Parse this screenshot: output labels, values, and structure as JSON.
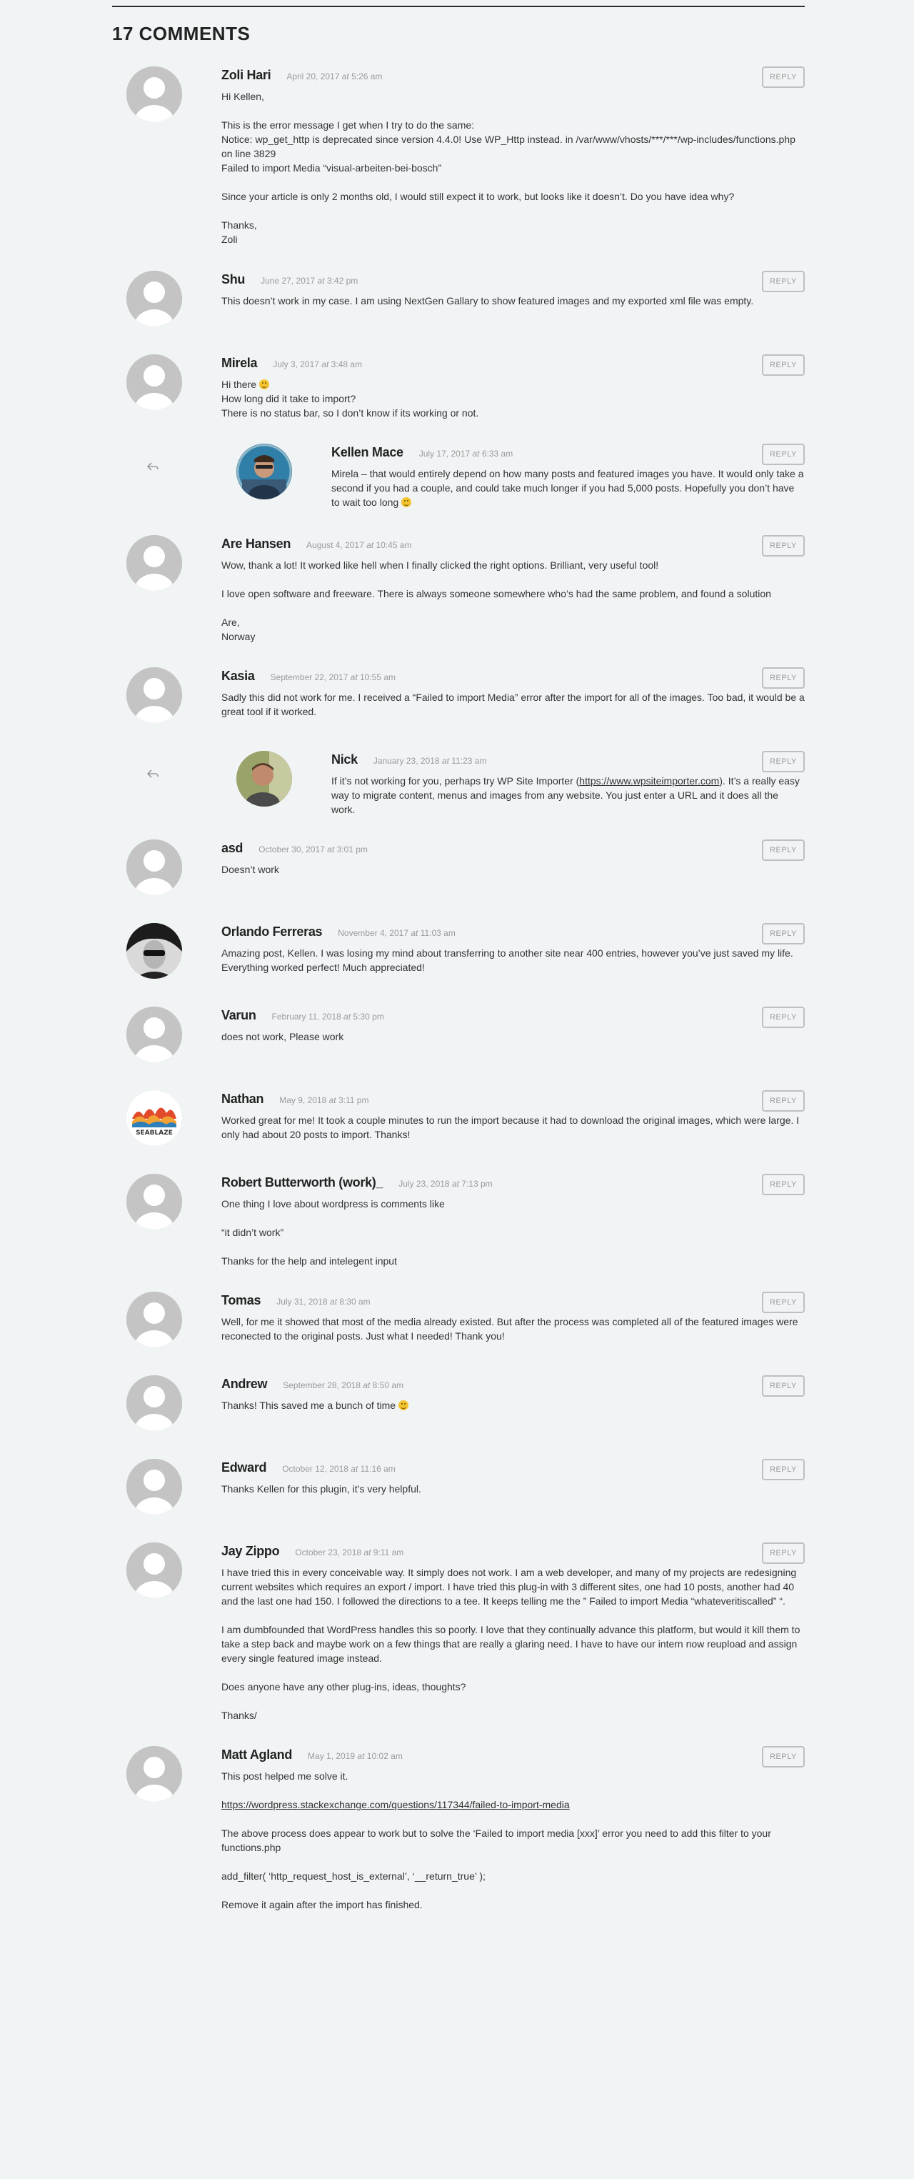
{
  "comments_title": "17 Comments",
  "reply_label": "Reply",
  "comments": [
    {
      "author": "Zoli Hari",
      "date": "April 20, 2017",
      "time": "5:26 am",
      "avatar": "default-avatar",
      "paragraphs": [
        "Hi Kellen,",
        "This is the error message I get when I try to do the same:\nNotice: wp_get_http is deprecated since version 4.4.0! Use WP_Http instead. in /var/www/vhosts/***/***/wp-includes/functions.php on line 3829\nFailed to import Media “visual-arbeiten-bei-bosch”",
        "Since your article is only 2 months old, I would still expect it to work, but looks like it doesn’t. Do you have idea why?",
        "Thanks,\nZoli"
      ]
    },
    {
      "author": "Shu",
      "date": "June 27, 2017",
      "time": "3:42 pm",
      "avatar": "default-avatar",
      "paragraphs": [
        "This doesn’t work in my case. I am using NextGen Gallary to show featured images and my exported xml file was empty."
      ]
    },
    {
      "author": "Mirela",
      "date": "July 3, 2017",
      "time": "3:48 am",
      "avatar": "default-avatar",
      "paragraphs": [
        "Hi there [smile]\nHow long did it take to import?\nThere is no status bar, so I don’t know if its working or not."
      ]
    },
    {
      "author": "Kellen Mace",
      "date": "July 17, 2017",
      "time": "6:33 am",
      "avatar": "kellen-photo",
      "child": true,
      "paragraphs": [
        "Mirela – that would entirely depend on how many posts and featured images you have. It would only take a second if you had a couple, and could take much longer if you had 5,000 posts. Hopefully you don’t have to wait too long [smile]"
      ]
    },
    {
      "author": "Are Hansen",
      "date": "August 4, 2017",
      "time": "10:45 am",
      "avatar": "default-avatar",
      "paragraphs": [
        "Wow, thank a lot! It worked like hell when I finally clicked the right options. Brilliant, very useful tool!",
        "I love open software and freeware. There is always someone somewhere who’s had the same problem, and found a solution",
        "Are,\nNorway"
      ]
    },
    {
      "author": "Kasia",
      "date": "September 22, 2017",
      "time": "10:55 am",
      "avatar": "default-avatar",
      "paragraphs": [
        "Sadly this did not work for me. I received a “Failed to import Media” error after the import for all of the images. Too bad, it would be a great tool if it worked."
      ]
    },
    {
      "author": "Nick",
      "date": "January 23, 2018",
      "time": "11:23 am",
      "avatar": "nick-photo",
      "child": true,
      "paragraphs": [
        "If it’s not working for you, perhaps try WP Site Importer ([link:https://www.wpsiteimporter.com]). It’s a really easy way to migrate content, menus and images from any website. You just enter a URL and it does all the work."
      ]
    },
    {
      "author": "asd",
      "date": "October 30, 2017",
      "time": "3:01 pm",
      "avatar": "default-avatar",
      "paragraphs": [
        "Doesn’t work"
      ]
    },
    {
      "author": "Orlando Ferreras",
      "date": "November 4, 2017",
      "time": "11:03 am",
      "avatar": "orlando-photo",
      "paragraphs": [
        "Amazing post, Kellen. I was losing my mind about transferring to another site near 400 entries, however you’ve just saved my life. Everything worked perfect! Much appreciated!"
      ]
    },
    {
      "author": "Varun",
      "date": "February 11, 2018",
      "time": "5:30 pm",
      "avatar": "default-avatar",
      "paragraphs": [
        "does not work, Please work"
      ]
    },
    {
      "author": "Nathan",
      "date": "May 9, 2018",
      "time": "3:11 pm",
      "avatar": "seablazer-logo",
      "logo_text": "SEABLAZE",
      "paragraphs": [
        "Worked great for me! It took a couple minutes to run the import because it had to download the original images, which were large. I only had about 20 posts to import. Thanks!"
      ]
    },
    {
      "author": "Robert Butterworth (work)_",
      "date": "July 23, 2018",
      "time": "7:13 pm",
      "avatar": "default-avatar",
      "paragraphs": [
        "One thing I love about wordpress is comments like",
        "“it didn’t work”",
        "Thanks for the help and intelegent input"
      ]
    },
    {
      "author": "Tomas",
      "date": "July 31, 2018",
      "time": "8:30 am",
      "avatar": "default-avatar",
      "paragraphs": [
        "Well, for me it showed that most of the media already existed. But after the process was completed all of the featured images were reconected to the original posts. Just what I needed! Thank you!"
      ]
    },
    {
      "author": "Andrew",
      "date": "September 28, 2018",
      "time": "8:50 am",
      "avatar": "default-avatar",
      "paragraphs": [
        "Thanks! This saved me a bunch of time [smile]"
      ]
    },
    {
      "author": "Edward",
      "date": "October 12, 2018",
      "time": "11:16 am",
      "avatar": "default-avatar",
      "paragraphs": [
        "Thanks Kellen for this plugin, it’s very helpful."
      ]
    },
    {
      "author": "Jay Zippo",
      "date": "October 23, 2018",
      "time": "9:11 am",
      "avatar": "default-avatar",
      "paragraphs": [
        "I have tried this in every conceivable way. It simply does not work. I am a web developer, and many of my projects are redesigning current websites which requires an export / import. I have tried this plug-in with 3 different sites, one had 10 posts, another had 40 and the last one had 150. I followed the directions to a tee. It keeps telling me the ” Failed to import Media “whateveritiscalled” “.",
        "I am dumbfounded that WordPress handles this so poorly. I love that they continually advance this platform, but would it kill them to take a step back and maybe work on a few things that are really a glaring need. I have to have our intern now reupload and assign every single featured image instead.",
        "Does anyone have any other plug-ins, ideas, thoughts?",
        "Thanks/"
      ]
    },
    {
      "author": "Matt Agland",
      "date": "May 1, 2019",
      "time": "10:02 am",
      "avatar": "default-avatar",
      "paragraphs": [
        "This post helped me solve it.",
        "[link:https://wordpress.stackexchange.com/questions/117344/failed-to-import-media]",
        "The above process does appear to work but to solve the ‘Failed to import media [xxx]’ error you need to add this filter to your functions.php",
        "add_filter( ‘http_request_host_is_external’, ‘__return_true’ );",
        "Remove it again after the import has finished."
      ]
    }
  ]
}
